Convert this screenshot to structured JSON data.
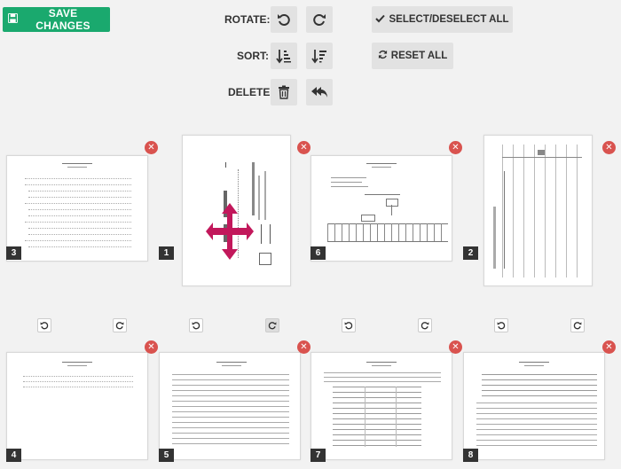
{
  "toolbar": {
    "save_label": "SAVE CHANGES",
    "rotate_label": "ROTATE:",
    "sort_label": "SORT:",
    "delete_label": "DELETE:",
    "select_all_label": "SELECT/DESELECT ALL",
    "reset_all_label": "RESET ALL"
  },
  "pages": [
    {
      "number": "3"
    },
    {
      "number": "1"
    },
    {
      "number": "6"
    },
    {
      "number": "2"
    },
    {
      "number": "4"
    },
    {
      "number": "5"
    },
    {
      "number": "7"
    },
    {
      "number": "8"
    }
  ],
  "colors": {
    "save": "#1aa96e",
    "delete": "#d9534f",
    "drag": "#c2185b"
  }
}
